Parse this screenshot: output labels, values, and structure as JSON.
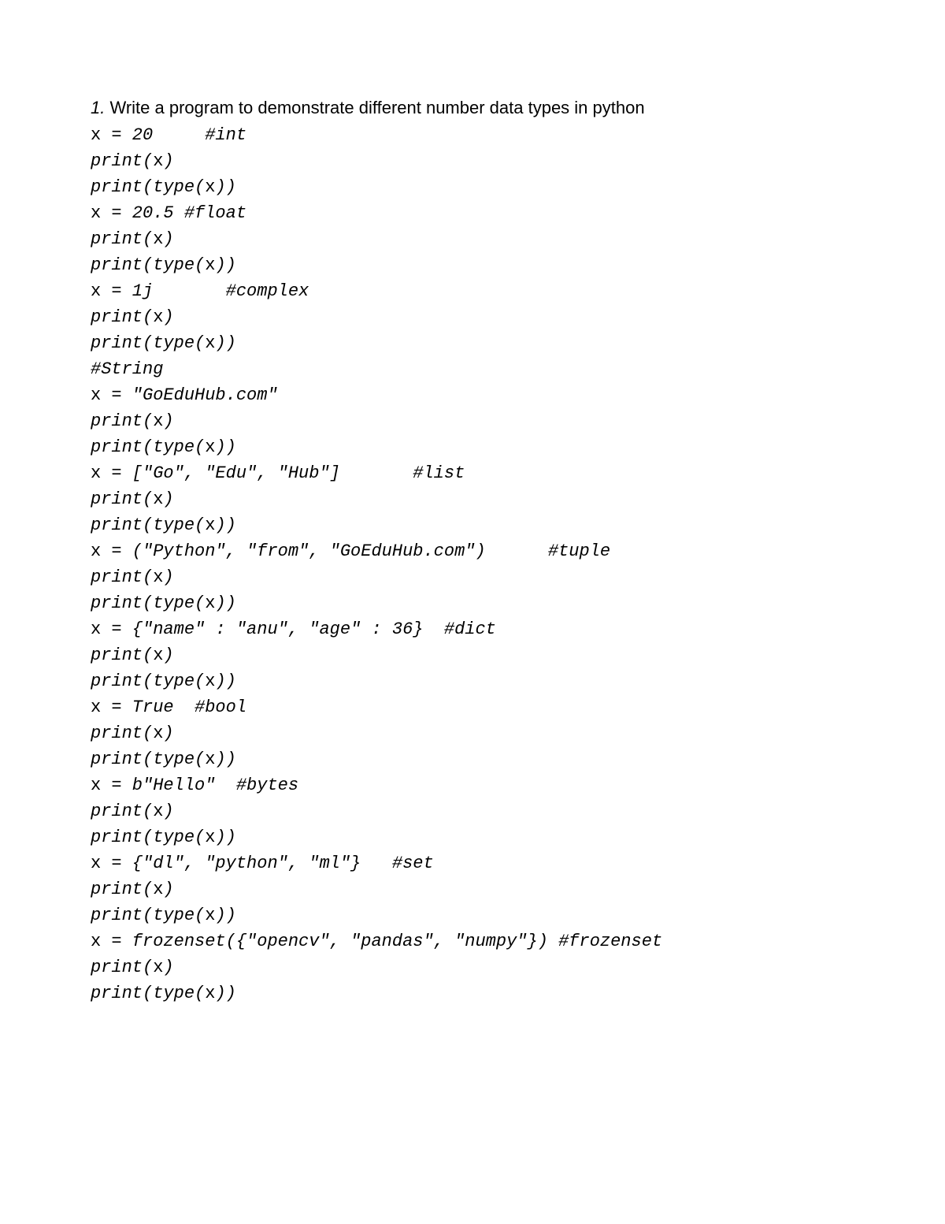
{
  "title": {
    "number": "1.",
    "text": " Write a program to demonstrate different number data types in python"
  },
  "lines": {
    "l1_a": "x",
    "l1_b": " = 20     #int",
    "l2_a": "print(",
    "l2_b": "x",
    "l2_c": ")",
    "l3_a": "print(type(",
    "l3_b": "x",
    "l3_c": "))",
    "l4_a": "x",
    "l4_b": " = 20.5 #float",
    "l5_a": "print(",
    "l5_b": "x",
    "l5_c": ")",
    "l6_a": "print(type(",
    "l6_b": "x",
    "l6_c": "))",
    "l7_a": "x",
    "l7_b": " = 1j       #complex",
    "l8_a": "print(",
    "l8_b": "x",
    "l8_c": ")",
    "l9_a": "print(type(",
    "l9_b": "x",
    "l9_c": "))",
    "l10": "#String",
    "l11_a": "x",
    "l11_b": " = \"GoEduHub.com\"",
    "l12_a": "print(",
    "l12_b": "x",
    "l12_c": ")",
    "l13_a": "print(type(",
    "l13_b": "x",
    "l13_c": "))",
    "l14_a": "x",
    "l14_b": " = [\"Go\", \"Edu\", \"Hub\"]       #list",
    "l15_a": "print(",
    "l15_b": "x",
    "l15_c": ")",
    "l16_a": "print(type(",
    "l16_b": "x",
    "l16_c": "))",
    "l17_a": "x",
    "l17_b": " = (\"Python\", \"from\", \"GoEduHub.com\")      #tuple",
    "l18_a": "print(",
    "l18_b": "x",
    "l18_c": ")",
    "l19_a": "print(type(",
    "l19_b": "x",
    "l19_c": "))",
    "l20_a": "x",
    "l20_b": " = {\"name\" : \"anu\", \"age\" : 36}  #dict",
    "l21_a": "print(",
    "l21_b": "x",
    "l21_c": ")",
    "l22_a": "print(type(",
    "l22_b": "x",
    "l22_c": "))",
    "l23_a": "x",
    "l23_b": " = True  #bool",
    "l24_a": "print(",
    "l24_b": "x",
    "l24_c": ")",
    "l25_a": "print(type(",
    "l25_b": "x",
    "l25_c": "))",
    "l26_a": "x",
    "l26_b": " = b\"Hello\"  #bytes",
    "l27_a": "print(",
    "l27_b": "x",
    "l27_c": ")",
    "l28_a": "print(type(",
    "l28_b": "x",
    "l28_c": "))",
    "l29_a": "x",
    "l29_b": " = {\"dl\", \"python\", \"ml\"}   #set",
    "l30_a": "print(",
    "l30_b": "x",
    "l30_c": ")",
    "l31_a": "print(type(",
    "l31_b": "x",
    "l31_c": "))",
    "l32_a": "x",
    "l32_b": " = frozenset({\"opencv\", \"pandas\", \"numpy\"}) #frozenset",
    "l33_a": "print(",
    "l33_b": "x",
    "l33_c": ")",
    "l34_a": "print(type(",
    "l34_b": "x",
    "l34_c": "))"
  }
}
